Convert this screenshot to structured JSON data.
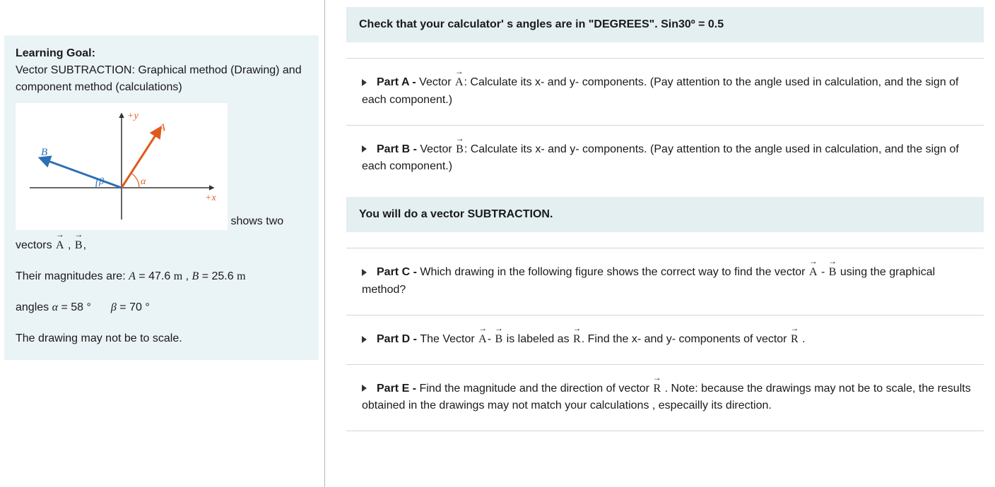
{
  "left": {
    "goal_label": "Learning Goal:",
    "goal_text": "Vector SUBTRACTION: Graphical method (Drawing)  and component method (calculations)",
    "shows_two": "shows two",
    "vectors_prefix": "vectors ",
    "vecA": "A",
    "comma_space": " , ",
    "vecB": "B",
    "trailing_comma": ",",
    "mag_prefix": "Their magnitudes are: ",
    "mag_A_sym": "A",
    "mag_A_eq": " = 47.6 ",
    "mag_A_unit": "m",
    "mag_sep": " , ",
    "mag_B_sym": "B",
    "mag_B_eq": " = 25.6 ",
    "mag_B_unit": "m",
    "ang_prefix": "angles ",
    "alpha_sym": "α",
    "alpha_eq": " = 58",
    "deg": " °",
    "beta_sym": "β",
    "beta_eq": " = 70",
    "note": "The drawing may not be to scale.",
    "fig": {
      "plus_y": "+y",
      "plus_x": "+x",
      "A": "A",
      "B": "B",
      "alpha": "α",
      "beta": "β"
    }
  },
  "right": {
    "hint": "Check that your calculator' s angles are in \"DEGREES\". Sin30º = 0.5",
    "sub_bar": "You will do a vector SUBTRACTION.",
    "parts": {
      "A": {
        "label": "Part A - ",
        "pre": "Vector ",
        "vec": "A",
        "post": ": Calculate its x- and y- components. (Pay attention to the angle used in calculation, and the sign of each component.)"
      },
      "B": {
        "label": "Part B - ",
        "pre": "Vector ",
        "vec": "B",
        "post": ": Calculate its x- and y- components. (Pay attention to the angle used in calculation, and the sign of each component.)"
      },
      "C": {
        "label": "Part C - ",
        "pre": "Which drawing in the following figure shows the correct way to find the vector ",
        "vecA": "A",
        "minus": " - ",
        "vecB": "B",
        "post": " using the graphical method?"
      },
      "D": {
        "label": "Part D - ",
        "pre": "The Vector ",
        "vecA": "A",
        "dash": "- ",
        "vecB": "B",
        "mid": " is labeled as ",
        "vecR": "R",
        "post": ". Find the  x- and y- components of vector ",
        "vecR2": "R",
        "end": " ."
      },
      "E": {
        "label": "Part E - ",
        "pre": "Find the magnitude and the direction of vector ",
        "vecR": "R",
        "post": " . Note: because the drawings may not be to scale, the results obtained in the drawings may not match your calculations , especailly its direction."
      }
    }
  }
}
